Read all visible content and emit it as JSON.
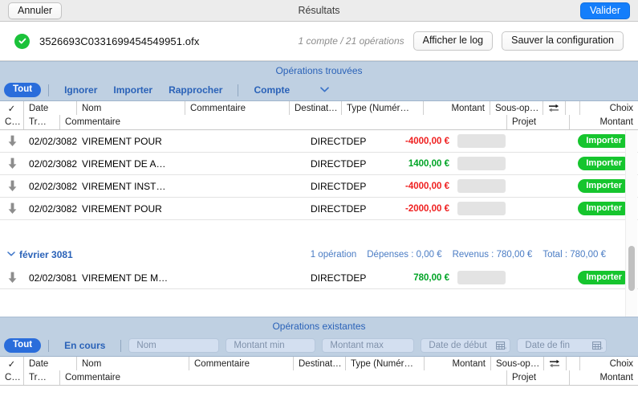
{
  "titlebar": {
    "cancel_label": "Annuler",
    "title": "Résultats",
    "validate_label": "Valider"
  },
  "filebar": {
    "status_icon": "check-circle-icon",
    "file_name": "3526693C0331699454549951.ofx",
    "summary": "1 compte / 21 opérations",
    "show_log_label": "Afficher le log",
    "save_config_label": "Sauver la configuration"
  },
  "found_section": {
    "banner_title": "Opérations trouvées",
    "toolbar": {
      "all_label": "Tout",
      "items": [
        {
          "label": "Ignorer"
        },
        {
          "label": "Importer"
        },
        {
          "label": "Rapprocher"
        },
        {
          "label": "Compte"
        }
      ],
      "chevron_icon": "chevron-down-icon"
    },
    "columns_row1": [
      "✓",
      "Date",
      "Nom",
      "Commentaire",
      "Destinat…",
      "Type (Numér…",
      "Montant",
      "Sous-op…",
      "swap-icon",
      "Choix"
    ],
    "columns_row2": [
      "C…",
      "Tr…",
      "Commentaire",
      "Projet",
      "Montant"
    ],
    "rows": [
      {
        "arrow": "down-arrow-icon",
        "date": "02/02/3082",
        "nom": "VIREMENT POUR",
        "commentaire": "",
        "destinataire": "",
        "type": "DIRECTDEP",
        "montant": "-4000,00 €",
        "sign": "neg",
        "sousop": "",
        "choix": "Importer"
      },
      {
        "arrow": "down-arrow-icon",
        "date": "02/02/3082",
        "nom": "VIREMENT DE A…",
        "commentaire": "",
        "destinataire": "",
        "type": "DIRECTDEP",
        "montant": "1400,00 €",
        "sign": "pos",
        "sousop": "",
        "choix": "Importer"
      },
      {
        "arrow": "down-arrow-icon",
        "date": "02/02/3082",
        "nom": "VIREMENT INST…",
        "commentaire": "",
        "destinataire": "",
        "type": "DIRECTDEP",
        "montant": "-4000,00 €",
        "sign": "neg",
        "sousop": "",
        "choix": "Importer"
      },
      {
        "arrow": "down-arrow-icon",
        "date": "02/02/3082",
        "nom": "VIREMENT POUR",
        "commentaire": "",
        "destinataire": "",
        "type": "DIRECTDEP",
        "montant": "-2000,00 €",
        "sign": "neg",
        "sousop": "",
        "choix": "Importer"
      }
    ],
    "group": {
      "chevron_icon": "chevron-down-icon",
      "label": "février 3081",
      "stats": [
        "1 opération",
        "Dépenses : 0,00 €",
        "Revenus : 780,00 €",
        "Total : 780,00 €"
      ],
      "rows": [
        {
          "arrow": "down-arrow-icon",
          "date": "02/02/3081",
          "nom": "VIREMENT DE M…",
          "commentaire": "",
          "destinataire": "",
          "type": "DIRECTDEP",
          "montant": "780,00 €",
          "sign": "pos",
          "sousop": "",
          "choix": "Importer"
        }
      ]
    }
  },
  "existing_section": {
    "banner_title": "Opérations existantes",
    "toolbar": {
      "all_label": "Tout",
      "in_progress_label": "En cours",
      "name_placeholder": "Nom",
      "name_value": "",
      "amount_min_placeholder": "Montant min",
      "amount_min_value": "",
      "amount_max_placeholder": "Montant max",
      "amount_max_value": "",
      "date_start_placeholder": "Date de début",
      "date_start_value": "",
      "date_end_placeholder": "Date de fin",
      "date_end_value": "",
      "calendar_icon": "calendar-icon"
    },
    "columns_row1": [
      "✓",
      "Date",
      "Nom",
      "Commentaire",
      "Destinat…",
      "Type (Numér…",
      "Montant",
      "Sous-op…",
      "swap-icon",
      "Choix"
    ],
    "columns_row2": [
      "C…",
      "Tr…",
      "Commentaire",
      "Projet",
      "Montant"
    ],
    "rows": []
  },
  "colors": {
    "accent_blue": "#2a62b8",
    "validate_blue": "#147efb",
    "banner_blue": "#bfd0e2",
    "green": "#16c52e",
    "negative_red": "#ef1f1f",
    "positive_green": "#00a426"
  },
  "scrollbar": {
    "thumb_top_pct": 62,
    "thumb_height_pct": 24
  }
}
